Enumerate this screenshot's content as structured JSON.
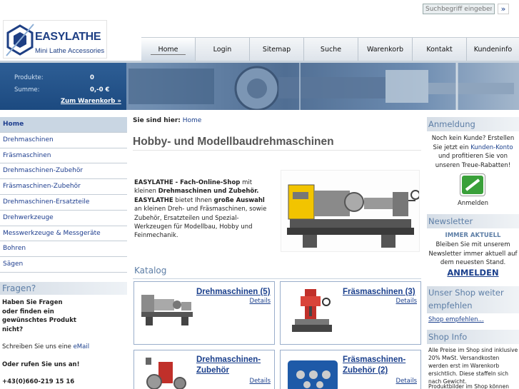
{
  "header": {
    "logo_text": "EASYLATHE",
    "logo_sub": "Mini Lathe Accessories",
    "search_placeholder": "Suchbegriff eingeben",
    "search_button": "»"
  },
  "nav": {
    "items": [
      {
        "label": "Home"
      },
      {
        "label": "Login"
      },
      {
        "label": "Sitemap"
      },
      {
        "label": "Suche"
      },
      {
        "label": "Warenkorb"
      },
      {
        "label": "Kontakt"
      },
      {
        "label": "Kundeninfo"
      }
    ]
  },
  "cart": {
    "products_label": "Produkte:",
    "products_value": "0",
    "sum_label": "Summe:",
    "sum_value": "0,-0 €",
    "link": "Zum Warenkorb »"
  },
  "sidebar": {
    "items": [
      {
        "label": "Home"
      },
      {
        "label": "Drehmaschinen"
      },
      {
        "label": "Fräsmaschinen"
      },
      {
        "label": "Drehmaschinen-Zubehör"
      },
      {
        "label": "Fräsmaschinen-Zubehör"
      },
      {
        "label": "Drehmaschinen-Ersatzteile"
      },
      {
        "label": "Drehwerkzeuge"
      },
      {
        "label": "Messwerkzeuge & Messgeräte"
      },
      {
        "label": "Bohren"
      },
      {
        "label": "Sägen"
      }
    ]
  },
  "fragen": {
    "title": "Fragen?",
    "line1": "Haben Sie Fragen",
    "line2": "oder finden ein",
    "line3": "gewünschtes Produkt",
    "line4": "nicht?",
    "write": "Schreiben Sie uns eine",
    "email": "eMail",
    "call": "Oder rufen Sie uns an!",
    "phone": "+43(0)660-219 15 16"
  },
  "main": {
    "breadcrumb_label": "Sie sind hier:",
    "breadcrumb_link": "Home",
    "title": "Hobby- und Modellbaudrehmaschinen",
    "intro": {
      "shop": "EASYLATHE - Fach-Online-Shop",
      "t1": " mit kleinen ",
      "machines": "Drehmaschinen und Zubehör.",
      "brand": "EASYLATHE",
      "t2": " bietet Ihnen ",
      "choice": "große Auswahl",
      "t3": " an kleinen Dreh- und Fräsmaschinen, sowie Zubehör, Ersatzteilen und Spezial-Werkzeugen für Modellbau, Hobby und Feinmechanik."
    },
    "katalog": "Katalog",
    "cards": [
      {
        "title": "Drehmaschinen (5)",
        "details": "Details"
      },
      {
        "title": "Fräsmaschinen (3)",
        "details": "Details"
      },
      {
        "title": "Drehmaschinen-Zubehör",
        "details": "Details"
      },
      {
        "title": "Fräsmaschinen-Zubehör (2)",
        "details": "Details"
      }
    ]
  },
  "right": {
    "login_title": "Anmeldung",
    "login_text1": "Noch kein Kunde? Erstellen Sie jetzt ein ",
    "login_link": "Kunden-Konto",
    "login_text2": " und profitieren Sie von unseren Treue-Rabatten!",
    "login_button": "Anmelden",
    "news_title": "Newsletter",
    "news_sub": "IMMER AKTUELL",
    "news_text": "Bleiben Sie mit unserem Newsletter immer aktuell auf dem neuesten Stand.",
    "news_button": "ANMELDEN",
    "recommend_title": "Unser Shop weiter empfehlen",
    "recommend_link": "Shop empfehlen...",
    "info_title": "Shop Info",
    "info_text": "Alle Preise im Shop sind inklusive 20% MwSt. Versandkosten werden erst im Warenkorb ersichtlich. Diese staffeln sich nach Gewicht.",
    "info_more": "Produktbilder im Shop können"
  },
  "colors": {
    "brand_blue": "#1e3f84",
    "link_blue": "#1a3f8c",
    "heading_blue": "#5d7ea6",
    "card_border": "#9aaecb"
  }
}
